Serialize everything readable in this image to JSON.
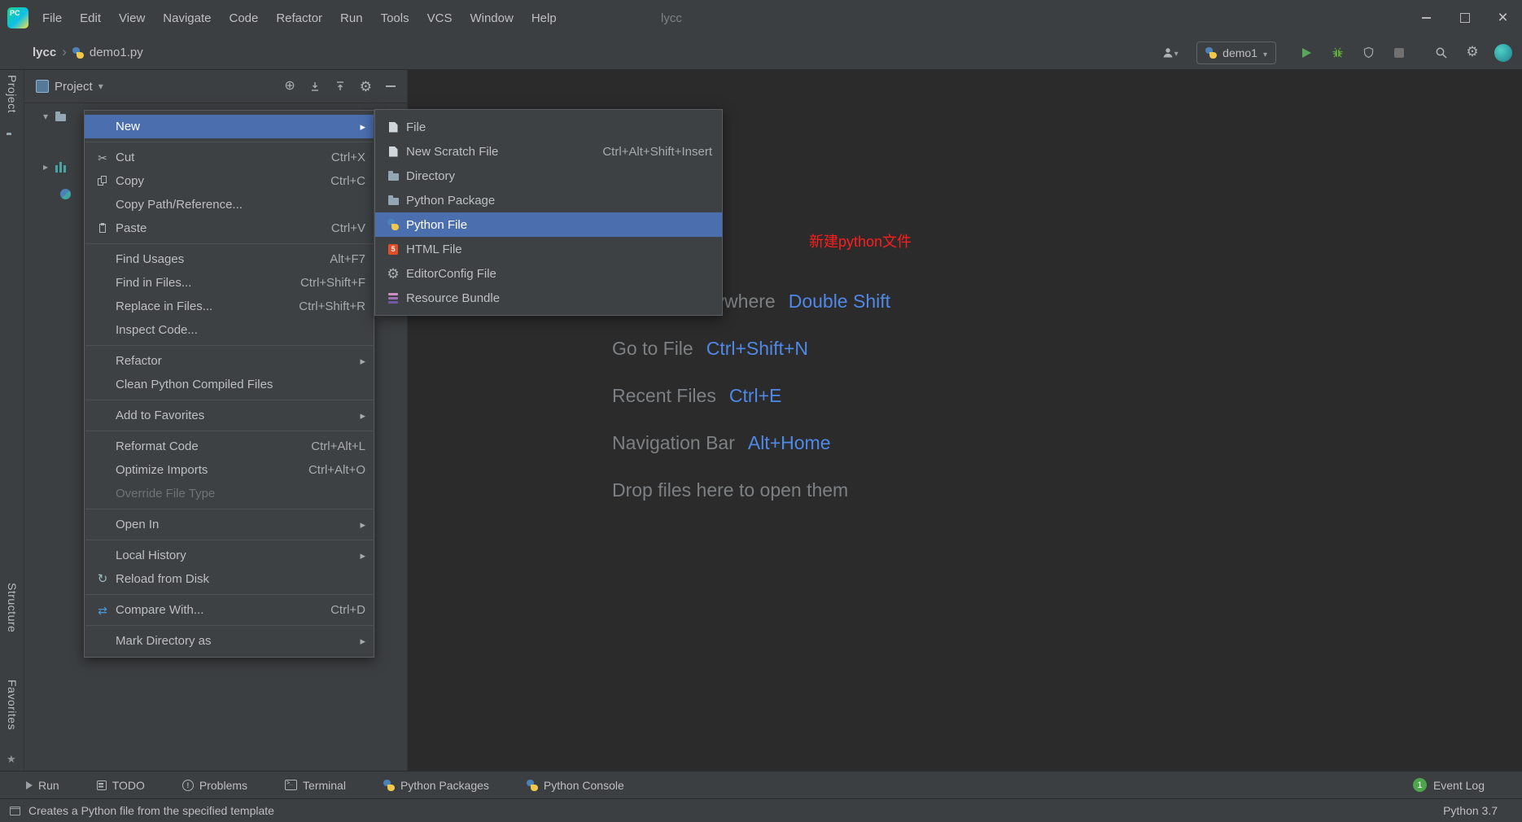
{
  "titlebar": {
    "logo_text": "PC",
    "menus": [
      "File",
      "Edit",
      "View",
      "Navigate",
      "Code",
      "Refactor",
      "Run",
      "Tools",
      "VCS",
      "Window",
      "Help"
    ],
    "window_title": "lycc"
  },
  "navbar": {
    "project_crumb": "lycc",
    "file_crumb": "demo1.py",
    "run_config": "demo1"
  },
  "stripe": {
    "project": "Project",
    "structure": "Structure",
    "favorites": "Favorites"
  },
  "project_panel": {
    "title": "Project"
  },
  "context_menu": {
    "items": [
      {
        "label": "New",
        "shortcut": "",
        "selected": true
      },
      {
        "label": "Cut",
        "shortcut": "Ctrl+X"
      },
      {
        "label": "Copy",
        "shortcut": "Ctrl+C"
      },
      {
        "label": "Copy Path/Reference...",
        "shortcut": ""
      },
      {
        "label": "Paste",
        "shortcut": "Ctrl+V"
      },
      {
        "label": "Find Usages",
        "shortcut": "Alt+F7"
      },
      {
        "label": "Find in Files...",
        "shortcut": "Ctrl+Shift+F"
      },
      {
        "label": "Replace in Files...",
        "shortcut": "Ctrl+Shift+R"
      },
      {
        "label": "Inspect Code...",
        "shortcut": ""
      },
      {
        "label": "Refactor",
        "shortcut": ""
      },
      {
        "label": "Clean Python Compiled Files",
        "shortcut": ""
      },
      {
        "label": "Add to Favorites",
        "shortcut": ""
      },
      {
        "label": "Reformat Code",
        "shortcut": "Ctrl+Alt+L"
      },
      {
        "label": "Optimize Imports",
        "shortcut": "Ctrl+Alt+O"
      },
      {
        "label": "Override File Type",
        "shortcut": "",
        "disabled": true
      },
      {
        "label": "Open In",
        "shortcut": ""
      },
      {
        "label": "Local History",
        "shortcut": ""
      },
      {
        "label": "Reload from Disk",
        "shortcut": ""
      },
      {
        "label": "Compare With...",
        "shortcut": "Ctrl+D"
      },
      {
        "label": "Mark Directory as",
        "shortcut": ""
      }
    ]
  },
  "submenu": {
    "items": [
      {
        "label": "File",
        "shortcut": ""
      },
      {
        "label": "New Scratch File",
        "shortcut": "Ctrl+Alt+Shift+Insert"
      },
      {
        "label": "Directory",
        "shortcut": ""
      },
      {
        "label": "Python Package",
        "shortcut": ""
      },
      {
        "label": "Python File",
        "shortcut": "",
        "selected": true
      },
      {
        "label": "HTML File",
        "shortcut": ""
      },
      {
        "label": "EditorConfig File",
        "shortcut": ""
      },
      {
        "label": "Resource Bundle",
        "shortcut": ""
      }
    ]
  },
  "editor": {
    "annotation": "新建python文件",
    "hints": [
      {
        "label": "Search Everywhere",
        "shortcut": "Double Shift"
      },
      {
        "label": "Go to File",
        "shortcut": "Ctrl+Shift+N"
      },
      {
        "label": "Recent Files",
        "shortcut": "Ctrl+E"
      },
      {
        "label": "Navigation Bar",
        "shortcut": "Alt+Home"
      },
      {
        "label": "Drop files here to open them",
        "shortcut": ""
      }
    ]
  },
  "bottom_bar": {
    "tools": [
      "Run",
      "TODO",
      "Problems",
      "Terminal",
      "Python Packages",
      "Python Console"
    ],
    "event_count": "1",
    "event_label": "Event Log"
  },
  "status_bar": {
    "message": "Creates a Python file from the specified template",
    "interpreter": "Python 3.7"
  },
  "colors": {
    "selection_blue": "#4b6eaf",
    "shortcut_blue": "#5088e8",
    "annotation_red": "#fe1d1d",
    "panel_bg": "#3c3f41",
    "editor_bg": "#2b2b2b"
  }
}
